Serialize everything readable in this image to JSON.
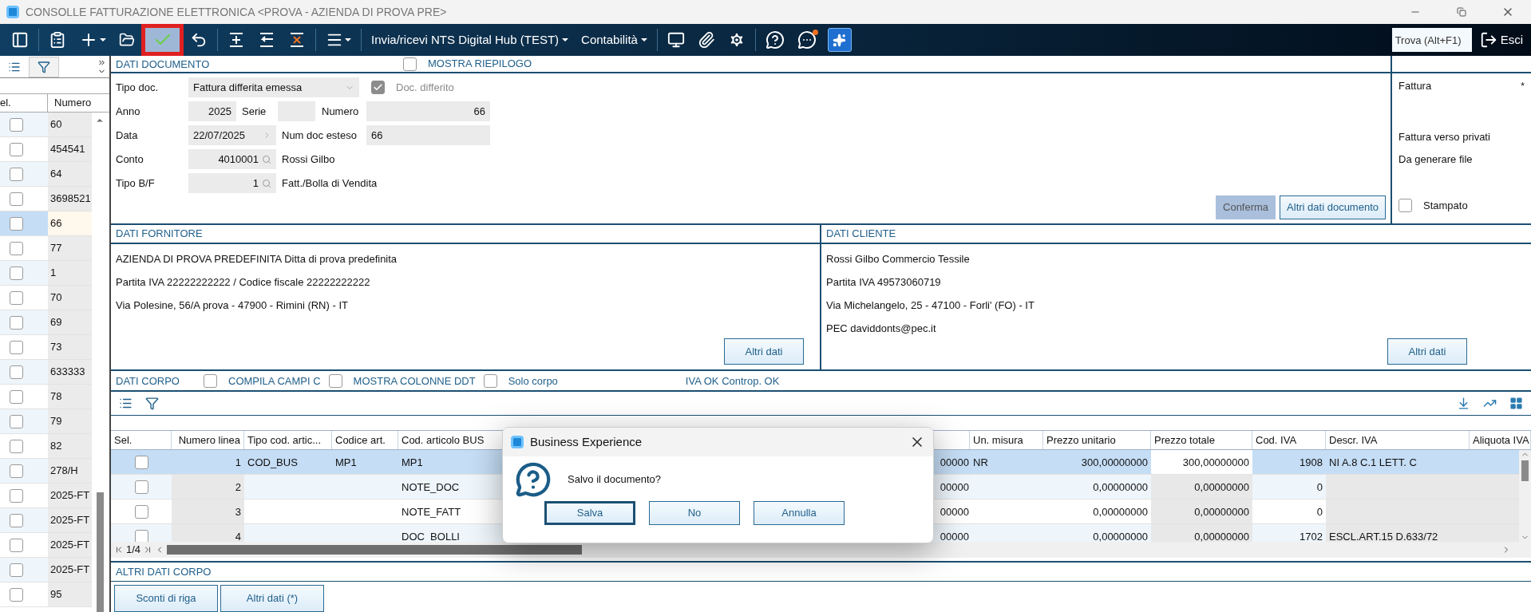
{
  "window": {
    "title": "CONSOLLE FATTURAZIONE ELETTRONICA <PROVA - AZIENDA DI PROVA PRE>"
  },
  "toolbar": {
    "save_button": {
      "highlighted": true
    },
    "menus": [
      {
        "label": "Invia/ricevi NTS Digital Hub (TEST)"
      },
      {
        "label": "Contabilità"
      }
    ],
    "search": {
      "placeholder": "Trova (Alt+F1)"
    },
    "exit_button": {
      "label": "Esci"
    }
  },
  "list": {
    "columns": [
      "el.",
      "Numero"
    ],
    "rows": [
      {
        "number": "60",
        "checked": false,
        "selected": false
      },
      {
        "number": "454541",
        "checked": false,
        "selected": false
      },
      {
        "number": "64",
        "checked": false,
        "selected": false
      },
      {
        "number": "3698521",
        "checked": false,
        "selected": false
      },
      {
        "number": "66",
        "checked": false,
        "selected": true
      },
      {
        "number": "77",
        "checked": false,
        "selected": false
      },
      {
        "number": "1",
        "checked": false,
        "selected": false
      },
      {
        "number": "70",
        "checked": false,
        "selected": false
      },
      {
        "number": "69",
        "checked": false,
        "selected": false
      },
      {
        "number": "73",
        "checked": false,
        "selected": false
      },
      {
        "number": "633333",
        "checked": false,
        "selected": false
      },
      {
        "number": "78",
        "checked": false,
        "selected": false
      },
      {
        "number": "79",
        "checked": false,
        "selected": false
      },
      {
        "number": "82",
        "checked": false,
        "selected": false
      },
      {
        "number": "278/H",
        "checked": false,
        "selected": false
      },
      {
        "number": "2025-FT",
        "checked": false,
        "selected": false
      },
      {
        "number": "2025-FT",
        "checked": false,
        "selected": false
      },
      {
        "number": "2025-FT",
        "checked": false,
        "selected": false
      },
      {
        "number": "2025-FT",
        "checked": false,
        "selected": false
      },
      {
        "number": "95",
        "checked": false,
        "selected": false
      }
    ]
  },
  "document": {
    "title": "DATI DOCUMENTO",
    "summary_toggle": {
      "label": "MOSTRA RIEPILOGO",
      "checked": false
    },
    "tipo_doc": {
      "label": "Tipo doc.",
      "value": "Fattura differita emessa"
    },
    "deferred": {
      "label": "Doc. differito",
      "checked": true
    },
    "anno": {
      "label": "Anno",
      "value": "2025"
    },
    "serie": {
      "label": "Serie"
    },
    "numero": {
      "label": "Numero",
      "value": "66"
    },
    "data": {
      "label": "Data",
      "value": "22/07/2025"
    },
    "num_doc_esteso": {
      "label": "Num doc esteso",
      "value": "66"
    },
    "conto": {
      "label": "Conto",
      "value": "4010001",
      "description": "Rossi Gilbo"
    },
    "tipo_bf": {
      "label": "Tipo B/F",
      "value": "1",
      "description": "Fatt./Bolla di Vendita"
    },
    "buttons": [
      {
        "label": "Conferma",
        "disabled": true
      },
      {
        "label": "Altri dati documento",
        "disabled": false
      }
    ]
  },
  "status_panel": {
    "type_label": "Fattura",
    "marker": "*",
    "lines": [
      "Fattura verso privati",
      "Da generare file"
    ],
    "printed": {
      "label": "Stampato",
      "checked": false
    }
  },
  "supplier": {
    "title": "DATI FORNITORE",
    "lines": [
      "AZIENDA DI PROVA PREDEFINITA Ditta di prova predefinita",
      "Partita IVA 22222222222 /  Codice fiscale 22222222222",
      "Via Polesine, 56/A prova - 47900 - Rimini (RN)  - IT"
    ],
    "button": "Altri dati"
  },
  "customer": {
    "title": "DATI CLIENTE",
    "lines": [
      "Rossi Gilbo Commercio Tessile",
      "Partita IVA 49573060719",
      "Via Michelangelo, 25 - 47100 - Forli' (FO)  - IT",
      "PEC daviddonts@pec.it"
    ],
    "button": "Altri dati"
  },
  "body": {
    "title": "DATI CORPO",
    "toggles": [
      {
        "label": "COMPILA CAMPI C",
        "checked": false
      },
      {
        "label": "MOSTRA COLONNE DDT",
        "checked": false
      },
      {
        "label": "Solo corpo",
        "checked": false
      }
    ],
    "status": "IVA OK Controp. OK",
    "table": {
      "columns": [
        "Sel.",
        "Numero linea",
        "Tipo cod. artic...",
        "Codice art.",
        "Cod. articolo BUS",
        "Un. misura",
        "Prezzo unitario",
        "Prezzo totale",
        "Cod. IVA",
        "Descr. IVA",
        "Aliquota IVA"
      ],
      "rows": [
        {
          "selected": true,
          "checked": false,
          "line": "1",
          "code_type": "COD_BUS",
          "code": "MP1",
          "bus_code": "MP1",
          "column_6": "00000",
          "unit": "NR",
          "unit_price": "300,00000000",
          "total_price": "300,00000000",
          "vat_code": "1908",
          "vat_description": "NI A.8 C.1 LETT. C"
        },
        {
          "selected": false,
          "checked": false,
          "line": "2",
          "bus_code": "NOTE_DOC",
          "column_6": "00000",
          "unit_price": "0,00000000",
          "total_price": "0,00000000",
          "vat_code": "0"
        },
        {
          "selected": false,
          "checked": false,
          "line": "3",
          "bus_code": "NOTE_FATT",
          "column_6": "00000",
          "unit_price": "0,00000000",
          "total_price": "0,00000000",
          "vat_code": "0"
        },
        {
          "selected": false,
          "checked": false,
          "line": "4",
          "bus_code": "DOC_BOLLI",
          "column_6": "00000",
          "unit_price": "0,00000000",
          "total_price": "0,00000000",
          "vat_code": "1702",
          "vat_description": "ESCL.ART.15 D.633/72"
        }
      ]
    },
    "pager": "1/4"
  },
  "body_extra": {
    "title": "ALTRI DATI CORPO",
    "buttons": [
      "Sconti di riga",
      "Altri dati (*)"
    ]
  },
  "dialog": {
    "title": "Business Experience",
    "message": "Salvo il documento?",
    "buttons": [
      {
        "label": "Salva",
        "default": true
      },
      {
        "label": "No",
        "default": false
      },
      {
        "label": "Annulla",
        "default": false
      }
    ]
  }
}
